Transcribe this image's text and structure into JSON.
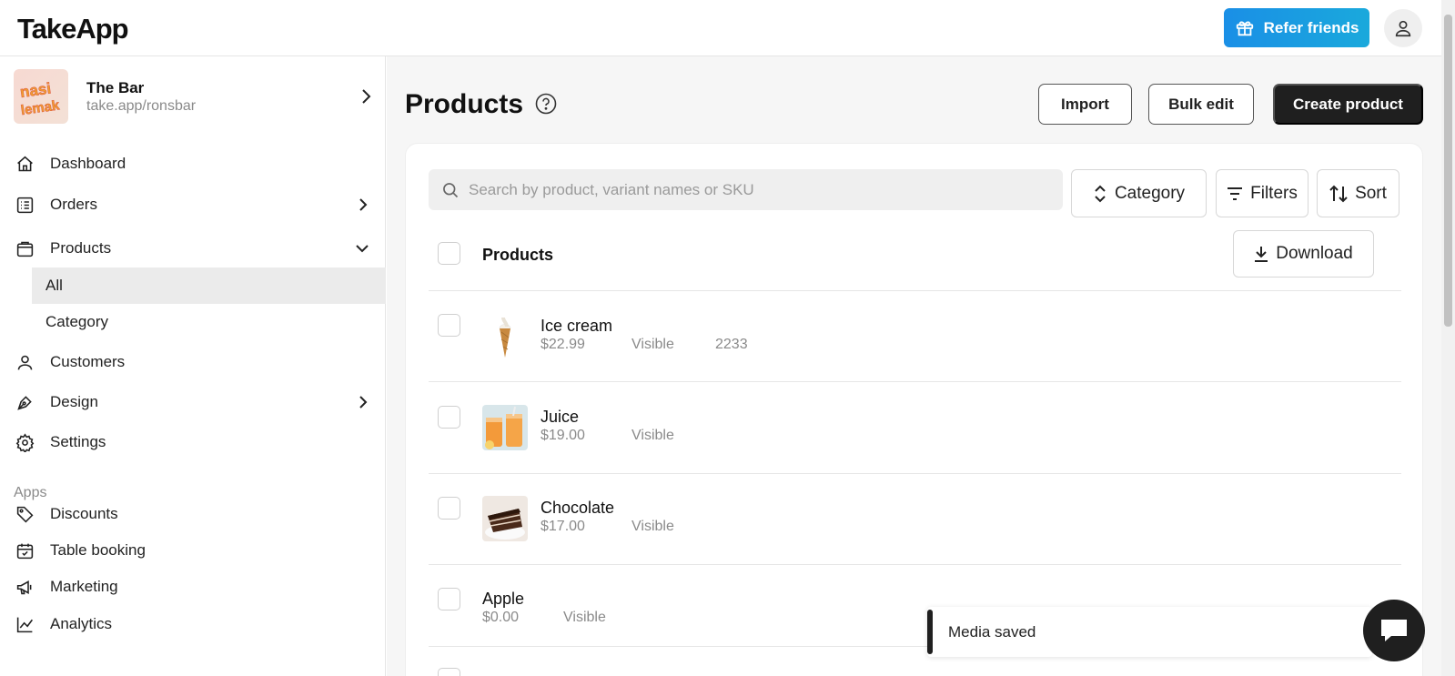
{
  "topbar": {
    "logo": "TakeApp",
    "refer_label": "Refer friends"
  },
  "store": {
    "name": "The Bar",
    "url": "take.app/ronsbar",
    "logo_text": "nasi lemak"
  },
  "nav": {
    "dashboard": "Dashboard",
    "orders": "Orders",
    "products": "Products",
    "products_sub": [
      "All",
      "Category"
    ],
    "customers": "Customers",
    "design": "Design",
    "settings": "Settings",
    "apps_label": "Apps",
    "discounts": "Discounts",
    "table_booking": "Table booking",
    "marketing": "Marketing",
    "analytics": "Analytics"
  },
  "main": {
    "title": "Products",
    "import_label": "Import",
    "bulk_edit_label": "Bulk edit",
    "create_label": "Create product",
    "search_placeholder": "Search by product, variant names or SKU",
    "category_label": "Category",
    "filters_label": "Filters",
    "sort_label": "Sort",
    "list_header": "Products",
    "download_label": "Download"
  },
  "products": [
    {
      "name": "Ice cream",
      "price": "$22.99",
      "status": "Visible",
      "sku": "2233"
    },
    {
      "name": "Juice",
      "price": "$19.00",
      "status": "Visible",
      "sku": ""
    },
    {
      "name": "Chocolate",
      "price": "$17.00",
      "status": "Visible",
      "sku": ""
    },
    {
      "name": "Apple",
      "price": "$0.00",
      "status": "Visible",
      "sku": ""
    }
  ],
  "toast": {
    "message": "Media saved"
  },
  "colors": {
    "accent": "#1a9ee2",
    "dark": "#1f1f1f",
    "muted": "#8a8a8a"
  }
}
